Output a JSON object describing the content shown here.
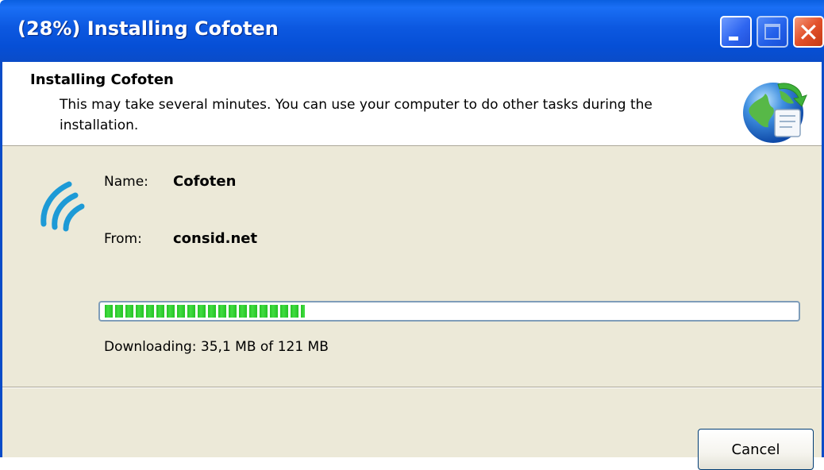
{
  "window": {
    "title": "(28%) Installing Cofoten"
  },
  "titlebar_buttons": {
    "minimize_icon": "minimize-icon",
    "maximize_icon": "maximize-icon",
    "close_icon": "close-icon",
    "close_glyph": "✕"
  },
  "header": {
    "title": "Installing Cofoten",
    "description": "This may take several minutes. You can use your computer to do other tasks during the installation.",
    "icon": "globe-install-icon"
  },
  "details": {
    "app_icon": "signal-waves-icon",
    "name_label": "Name:",
    "name_value": "Cofoten",
    "from_label": "From:",
    "from_value": "consid.net"
  },
  "progress": {
    "fraction": 0.29,
    "status_text": "Downloading: 35,1 MB of 121 MB"
  },
  "buttons": {
    "cancel_label": "Cancel"
  },
  "colors": {
    "titlebar": "#0a5fe0",
    "body_bg": "#ece9d8",
    "progress_green": "#26c226",
    "close_red": "#e2502a"
  }
}
